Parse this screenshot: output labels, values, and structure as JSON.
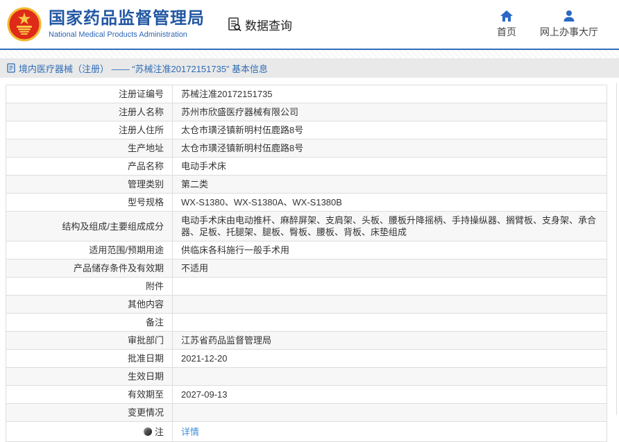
{
  "header": {
    "org_name_zh": "国家药品监督管理局",
    "org_name_en": "National Medical Products Administration",
    "section_label": "数据查询",
    "nav": [
      {
        "label": "首页",
        "icon": "home-icon"
      },
      {
        "label": "网上办事大厅",
        "icon": "user-icon"
      }
    ]
  },
  "breadcrumb": {
    "text": "境内医疗器械（注册） —— “苏械注准20172151735” 基本信息"
  },
  "colors": {
    "accent_blue": "#2e6db8",
    "title_blue": "#2257a3",
    "link_blue": "#3f8fd8",
    "crumb_bg": "#e9e9e9",
    "stripe": "#f7f7f7",
    "emblem_red": "#de2a18",
    "emblem_gold": "#f2b931"
  },
  "table": {
    "rows": [
      {
        "label": "注册证编号",
        "value": "苏械注准20172151735"
      },
      {
        "label": "注册人名称",
        "value": "苏州市欣盛医疗器械有限公司"
      },
      {
        "label": "注册人住所",
        "value": "太仓市璜泾镇新明村伍鹿路8号"
      },
      {
        "label": "生产地址",
        "value": "太仓市璜泾镇新明村伍鹿路8号"
      },
      {
        "label": "产品名称",
        "value": "电动手术床"
      },
      {
        "label": "管理类别",
        "value": "第二类"
      },
      {
        "label": "型号规格",
        "value": "WX-S1380、WX-S1380A、WX-S1380B"
      },
      {
        "label": "结构及组成/主要组成成分",
        "value": "电动手术床由电动推杆、麻醉屏架、支肩架、头板、腰板升降摇柄、手持操纵器、搁臂板、支身架、承合器、足板、托腿架、腿板、臀板、腰板、背板、床垫组成"
      },
      {
        "label": "适用范围/预期用途",
        "value": "供临床各科施行一般手术用"
      },
      {
        "label": "产品储存条件及有效期",
        "value": "不适用"
      },
      {
        "label": "附件",
        "value": ""
      },
      {
        "label": "其他内容",
        "value": ""
      },
      {
        "label": "备注",
        "value": ""
      },
      {
        "label": "审批部门",
        "value": "江苏省药品监督管理局"
      },
      {
        "label": "批准日期",
        "value": "2021-12-20"
      },
      {
        "label": "生效日期",
        "value": ""
      },
      {
        "label": "有效期至",
        "value": "2027-09-13"
      },
      {
        "label": "变更情况",
        "value": ""
      },
      {
        "label": "注",
        "value": "详情",
        "value_is_link": true,
        "label_icon": "note-icon"
      }
    ]
  }
}
